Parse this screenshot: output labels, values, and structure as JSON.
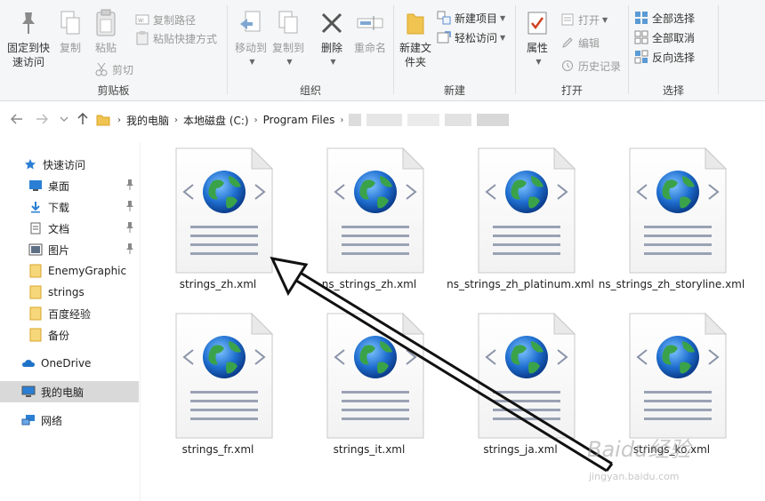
{
  "ribbon": {
    "clipboard": {
      "label": "剪贴板",
      "pin_quick_access": "固定到快速访问",
      "copy": "复制",
      "paste": "粘贴",
      "copy_path": "复制路径",
      "paste_shortcut": "粘贴快捷方式",
      "cut": "剪切"
    },
    "organize": {
      "label": "组织",
      "move_to": "移动到",
      "copy_to": "复制到",
      "delete": "删除",
      "rename": "重命名"
    },
    "new": {
      "label": "新建",
      "new_folder": "新建文件夹",
      "new_item": "新建项目",
      "easy_access": "轻松访问"
    },
    "open": {
      "label": "打开",
      "properties": "属性",
      "open": "打开",
      "edit": "编辑",
      "history": "历史记录"
    },
    "select": {
      "label": "选择",
      "select_all": "全部选择",
      "select_none": "全部取消",
      "invert": "反向选择"
    }
  },
  "address": {
    "crumbs": [
      "我的电脑",
      "本地磁盘 (C:)",
      "Program Files"
    ]
  },
  "sidebar": {
    "items": [
      {
        "label": "快速访问",
        "icon": "star-icon"
      },
      {
        "label": "桌面",
        "icon": "desktop-icon"
      },
      {
        "label": "下载",
        "icon": "download-icon"
      },
      {
        "label": "文档",
        "icon": "document-icon"
      },
      {
        "label": "图片",
        "icon": "picture-icon"
      },
      {
        "label": "EnemyGraphic",
        "icon": "folder-icon"
      },
      {
        "label": "strings",
        "icon": "folder-icon"
      },
      {
        "label": "百度经验",
        "icon": "folder-icon"
      },
      {
        "label": "备份",
        "icon": "folder-icon"
      },
      {
        "label": "OneDrive",
        "icon": "cloud-icon"
      },
      {
        "label": "我的电脑",
        "icon": "computer-icon"
      },
      {
        "label": "网络",
        "icon": "network-icon"
      }
    ]
  },
  "files": [
    {
      "name": "strings_zh.xml"
    },
    {
      "name": "ns_strings_zh.xml"
    },
    {
      "name": "ns_strings_zh_platinum.xml"
    },
    {
      "name": "ns_strings_zh_storyline.xml"
    },
    {
      "name": "strings_fr.xml"
    },
    {
      "name": "strings_it.xml"
    },
    {
      "name": "strings_ja.xml"
    },
    {
      "name": "strings_ko.xml"
    }
  ],
  "watermark": {
    "text": "Baidu经验",
    "sub": "jingyan.baidu.com"
  },
  "colors": {
    "accent": "#0078d7",
    "folder": "#f0c450",
    "selected": "#d9d9d9"
  }
}
